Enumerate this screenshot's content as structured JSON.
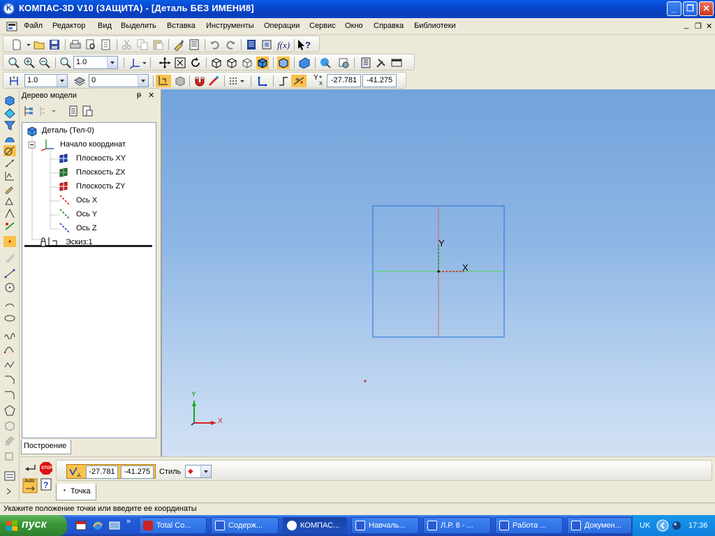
{
  "window": {
    "title": "КОМПАС-3D V10 (ЗАЩИТА) - [Деталь БЕЗ ИМЕНИ8]",
    "min": "_",
    "max": "❐",
    "close": "✕"
  },
  "menu": [
    "Файл",
    "Редактор",
    "Вид",
    "Выделить",
    "Вставка",
    "Инструменты",
    "Операции",
    "Сервис",
    "Окно",
    "Справка",
    "Библиотеки"
  ],
  "toolbar": {
    "scale_value": "1.0",
    "step_value": "1.0",
    "layer_value": "0",
    "coord_x": "-27.781",
    "coord_y": "-41.275",
    "coord_label": "Y"
  },
  "tree": {
    "header": "Дерево модели",
    "pin": "ᵽ",
    "close": "✕",
    "items": [
      {
        "label": "Деталь (Тел-0)"
      },
      {
        "label": "Начало координат"
      },
      {
        "label": "Плоскость XY"
      },
      {
        "label": "Плоскость ZX"
      },
      {
        "label": "Плоскость ZY"
      },
      {
        "label": "Ось X"
      },
      {
        "label": "Ось Y"
      },
      {
        "label": "Ось Z"
      },
      {
        "label": "Эскиз:1"
      }
    ],
    "tab": "Построение"
  },
  "viewport": {
    "sketch_axis_y": "Y",
    "sketch_axis_x": "X",
    "triad_y": "Y",
    "triad_x": "X",
    "colors": {
      "frame": "#1f6fd6",
      "x_axis": "#4fdc4f",
      "y_axis": "#e06060"
    }
  },
  "props": {
    "point_x": "-27.781",
    "point_y": "-41.275",
    "style_label": "Стиль",
    "tab_label": "Точка",
    "stop_label": "STOP",
    "auto_label": "Auto"
  },
  "status": "Укажите положение точки или введите ее координаты",
  "taskbar": {
    "start": "пуск",
    "tasks": [
      "Total Co...",
      "Содерж...",
      "КОМПАС...",
      "Навчаль...",
      "Л.Р. 8 - ...",
      "Работа ...",
      "Докумен..."
    ],
    "lang": "UK",
    "time": "17:36"
  }
}
